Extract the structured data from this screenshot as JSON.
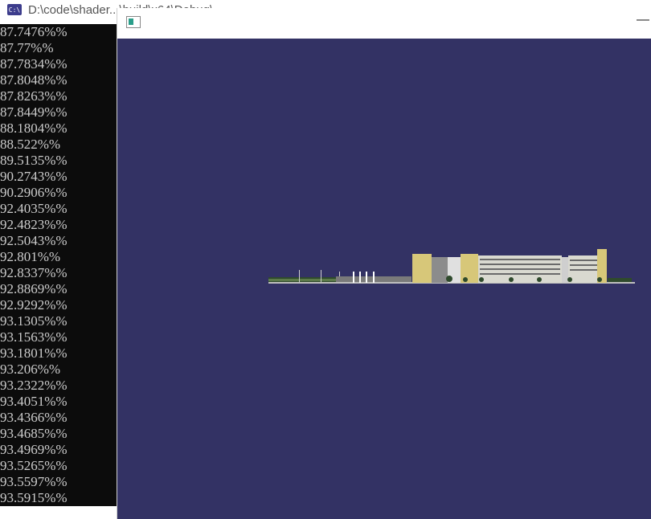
{
  "console": {
    "title": "D:\\code\\shader...\\build\\x64\\Debug\\...",
    "icon": "console-icon",
    "icon_text": "C:\\",
    "lines": [
      "87.7476%%",
      "87.77%%",
      "87.7834%%",
      "87.8048%%",
      "87.8263%%",
      "87.8449%%",
      "88.1804%%",
      "88.522%%",
      "89.5135%%",
      "90.2743%%",
      "90.2906%%",
      "92.4035%%",
      "92.4823%%",
      "92.5043%%",
      "92.801%%",
      "92.8337%%",
      "92.8869%%",
      "92.9292%%",
      "93.1305%%",
      "93.1563%%",
      "93.1801%%",
      "93.206%%",
      "93.2322%%",
      "93.4051%%",
      "93.4366%%",
      "93.4685%%",
      "93.4969%%",
      "93.5265%%",
      "93.5597%%",
      "93.5915%%"
    ]
  },
  "gl_window": {
    "icon": "app-window-icon",
    "minimize_label": "—",
    "background": "#333264"
  }
}
